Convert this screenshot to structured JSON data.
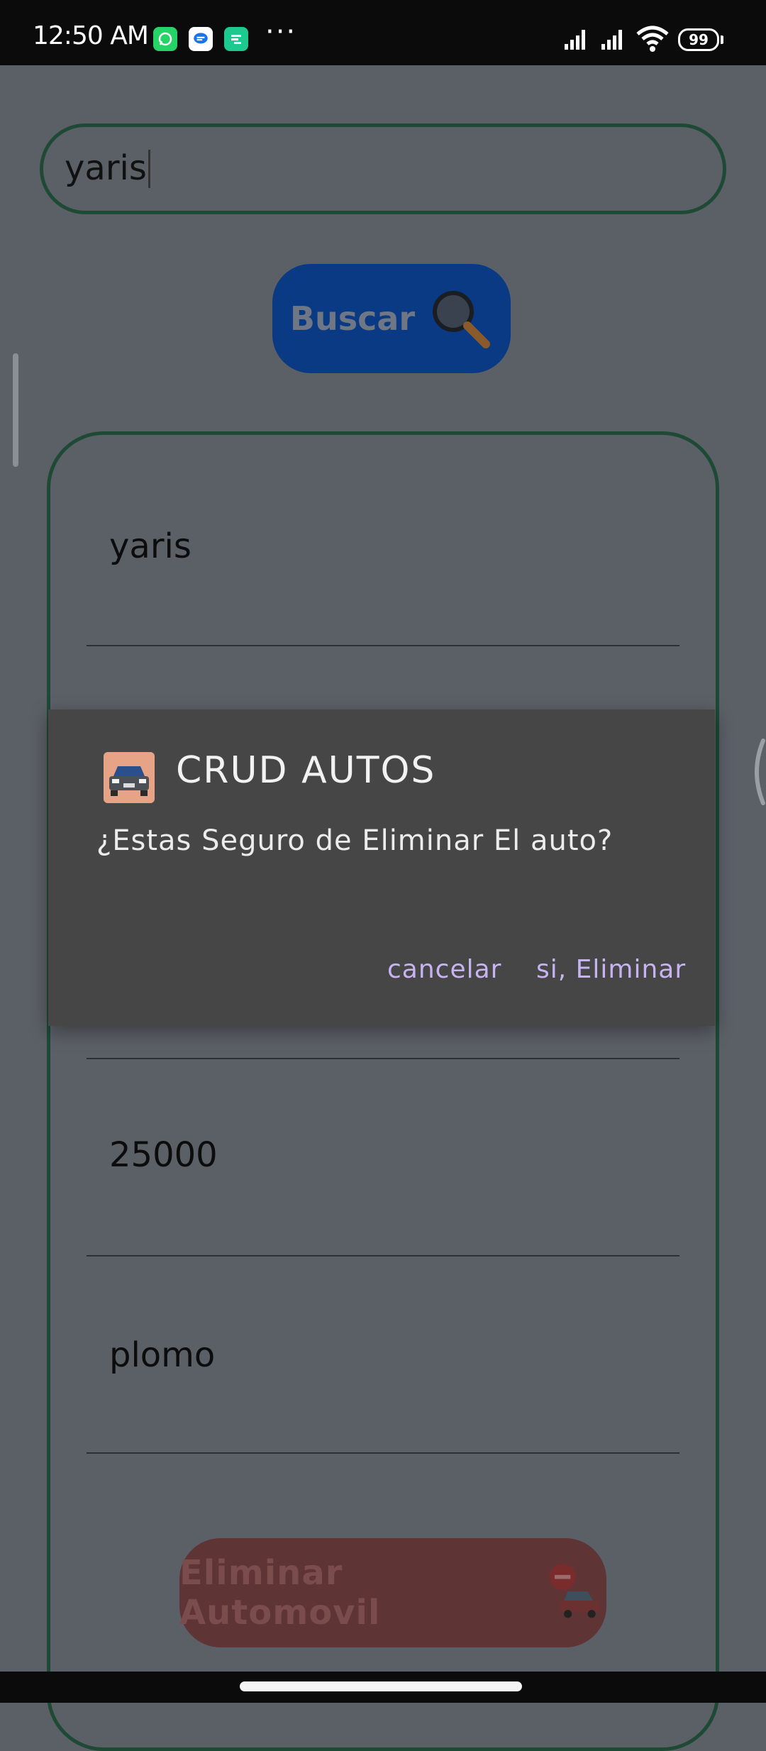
{
  "status_bar": {
    "time": "12:50 AM",
    "battery": "99",
    "more": "···",
    "apps": [
      "whatsapp-icon",
      "messenger-icon",
      "app-icon"
    ]
  },
  "search": {
    "value": "yaris",
    "button_label": "Buscar"
  },
  "form": {
    "fields": [
      "yaris",
      "25000",
      "plomo"
    ],
    "delete_label": "Eliminar Automovil"
  },
  "dialog": {
    "title": "CRUD AUTOS",
    "message": "¿Estas Seguro de Eliminar El auto?",
    "cancel": "cancelar",
    "confirm": "si, Eliminar"
  },
  "colors": {
    "background": "#5b5f66",
    "border_green": "#1e4a35",
    "search_button": "#0a3a84",
    "delete_button": "#5e3435",
    "dialog_bg": "#464646",
    "dialog_action": "#c7b3f0"
  }
}
